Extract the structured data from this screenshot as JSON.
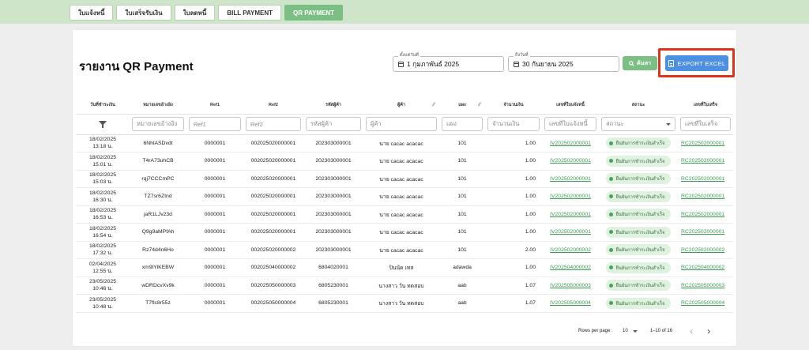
{
  "tabs": [
    {
      "label": "ใบแจ้งหนี้"
    },
    {
      "label": "ใบเสร็จรับเงิน"
    },
    {
      "label": "ใบลดหนี้"
    },
    {
      "label": "BILL PAYMENT"
    },
    {
      "label": "QR PAYMENT"
    }
  ],
  "page": {
    "title": "รายงาน QR Payment"
  },
  "filters": {
    "start_label": "ตั้งแต่วันที่",
    "start_value": "1 กุมภาพันธ์ 2025",
    "end_label": "ถึงวันที่",
    "end_value": "30 กันยายน 2025",
    "search_label": "ค้นหา",
    "export_label": "EXPORT EXCEL"
  },
  "columns": [
    "วันที่ชำระเงิน",
    "หมายเลขอ้างอิง",
    "Ref1",
    "Ref2",
    "รหัสผู้ค้า",
    "ผู้ค้า",
    "แผง",
    "จำนวนเงิน",
    "เลขที่ใบแจ้งหนี้",
    "สถานะ",
    "เลขที่ใบเสร็จ"
  ],
  "column_filters": [
    "หมายเลขอ้างอิง",
    "Ref1",
    "Ref2",
    "รหัสผู้ค้า",
    "ผู้ค้า",
    "แผง",
    "จำนวนเงิน",
    "เลขที่ใบแจ้งหนี้",
    "สถานะ",
    "เลขที่ใบเสร็จ"
  ],
  "rows": [
    {
      "d": "18/02/2025",
      "t": "13:18 น.",
      "ref": "6NhlASDvdt",
      "r1": "0000001",
      "r2": "002025020000001",
      "vc": "202303000001",
      "vn": "นาย cacac acacac",
      "st": "101",
      "amt": "1.00",
      "inv": "IV202502000001",
      "status": "ยืนยันการชำระเงินสำเร็จ",
      "rc": "RC202502000001"
    },
    {
      "d": "18/02/2025",
      "t": "15:01 น.",
      "ref": "T4rA73uhCB",
      "r1": "0000001",
      "r2": "002025020000001",
      "vc": "202303000001",
      "vn": "นาย cacac acacac",
      "st": "101",
      "amt": "1.00",
      "inv": "IV202502000001",
      "status": "ยืนยันการชำระเงินสำเร็จ",
      "rc": "RC202502000001"
    },
    {
      "d": "18/02/2025",
      "t": "15:03 น.",
      "ref": "rqj7CCCmPC",
      "r1": "0000001",
      "r2": "002025020000001",
      "vc": "202303000001",
      "vn": "นาย cacac acacac",
      "st": "101",
      "amt": "1.00",
      "inv": "IV202502000001",
      "status": "ยืนยันการชำระเงินสำเร็จ",
      "rc": "RC202502000001"
    },
    {
      "d": "18/02/2025",
      "t": "16:30 น.",
      "ref": "TZ7sr6ZInd",
      "r1": "0000001",
      "r2": "002025020000001",
      "vc": "202303000001",
      "vn": "นาย cacac acacac",
      "st": "101",
      "amt": "1.00",
      "inv": "IV202502000001",
      "status": "ยืนยันการชำระเงินสำเร็จ",
      "rc": "RC202502000001"
    },
    {
      "d": "18/02/2025",
      "t": "16:53 น.",
      "ref": "jaR1LJv23d",
      "r1": "0000001",
      "r2": "002025020000001",
      "vc": "202303000001",
      "vn": "นาย cacac acacac",
      "st": "101",
      "amt": "1.00",
      "inv": "IV202502000001",
      "status": "ยืนยันการชำระเงินสำเร็จ",
      "rc": "RC202502000001"
    },
    {
      "d": "18/02/2025",
      "t": "16:54 น.",
      "ref": "Q9g9aMPfAh",
      "r1": "0000001",
      "r2": "002025020000001",
      "vc": "202303000001",
      "vn": "นาย cacac acacac",
      "st": "101",
      "amt": "1.00",
      "inv": "IV202502000001",
      "status": "ยืนยันการชำระเงินสำเร็จ",
      "rc": "RC202502000001"
    },
    {
      "d": "18/02/2025",
      "t": "17:32 น.",
      "ref": "Rz74d4n6Ho",
      "r1": "0000001",
      "r2": "002025020000002",
      "vc": "202303000001",
      "vn": "นาย cacac acacac",
      "st": "101",
      "amt": "2.00",
      "inv": "IV202502000002",
      "status": "ยืนยันการชำระเงินสำเร็จ",
      "rc": "RC202502000002"
    },
    {
      "d": "02/04/2025",
      "t": "12:55 น.",
      "ref": "xm9lYlKEBW",
      "r1": "0000001",
      "r2": "002025040000002",
      "vc": "6804020001",
      "vn": "ปินนัด เทส",
      "st": "adawda",
      "amt": "1.00",
      "inv": "IV202504000002",
      "status": "ยืนยันการชำระเงินสำเร็จ",
      "rc": "RC202504000002"
    },
    {
      "d": "23/05/2025",
      "t": "10:46 น.",
      "ref": "wDRDcvXv9k",
      "r1": "0000001",
      "r2": "002025050000003",
      "vc": "6805230001",
      "vn": "นางสาว วัน ทดสอบ",
      "st": "aab",
      "amt": "1.07",
      "inv": "IV202505000003",
      "status": "ยืนยันการชำระเงินสำเร็จ",
      "rc": "RC202505000003"
    },
    {
      "d": "23/05/2025",
      "t": "10:48 น.",
      "ref": "T7flc8r55z",
      "r1": "0000001",
      "r2": "002025050000004",
      "vc": "6805230001",
      "vn": "นางสาว วัน ทดสอบ",
      "st": "aab",
      "amt": "1.07",
      "inv": "IV202505000004",
      "status": "ยืนยันการชำระเงินสำเร็จ",
      "rc": "RC202505000004"
    }
  ],
  "pagination": {
    "rows_label": "Rows per page:",
    "rows_value": "10",
    "range": "1–10 of 16",
    "prev": "‹",
    "next": "›"
  }
}
